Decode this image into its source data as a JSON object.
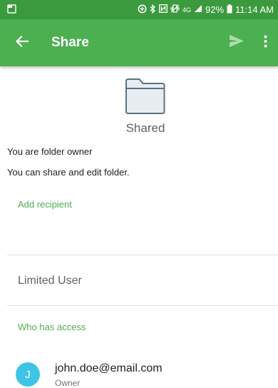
{
  "status_bar": {
    "battery": "92%",
    "time": "11:14 AM",
    "network": "4G",
    "icons": [
      "notification-icon",
      "data-saver-icon",
      "bluetooth-icon",
      "nfc-icon",
      "vibrate-icon",
      "signal-icon",
      "battery-icon"
    ]
  },
  "app_bar": {
    "title": "Share",
    "back_icon": "arrow-back-icon",
    "send_icon": "send-icon",
    "more_icon": "more-vert-icon",
    "color": "#4caf50"
  },
  "folder": {
    "icon": "folder-icon",
    "name": "Shared"
  },
  "info": {
    "owner_text": "You are folder owner",
    "permission_text": "You can share and edit folder."
  },
  "actions": {
    "add_recipient": "Add recipient"
  },
  "role": {
    "label": "Limited User"
  },
  "access": {
    "header": "Who has access",
    "users": [
      {
        "initial": "J",
        "email": "john.doe@email.com",
        "role": "Owner",
        "avatar_color": "#3fc4e8"
      }
    ]
  },
  "colors": {
    "accent": "#4caf50",
    "status_bar": "#3c9a3e"
  }
}
